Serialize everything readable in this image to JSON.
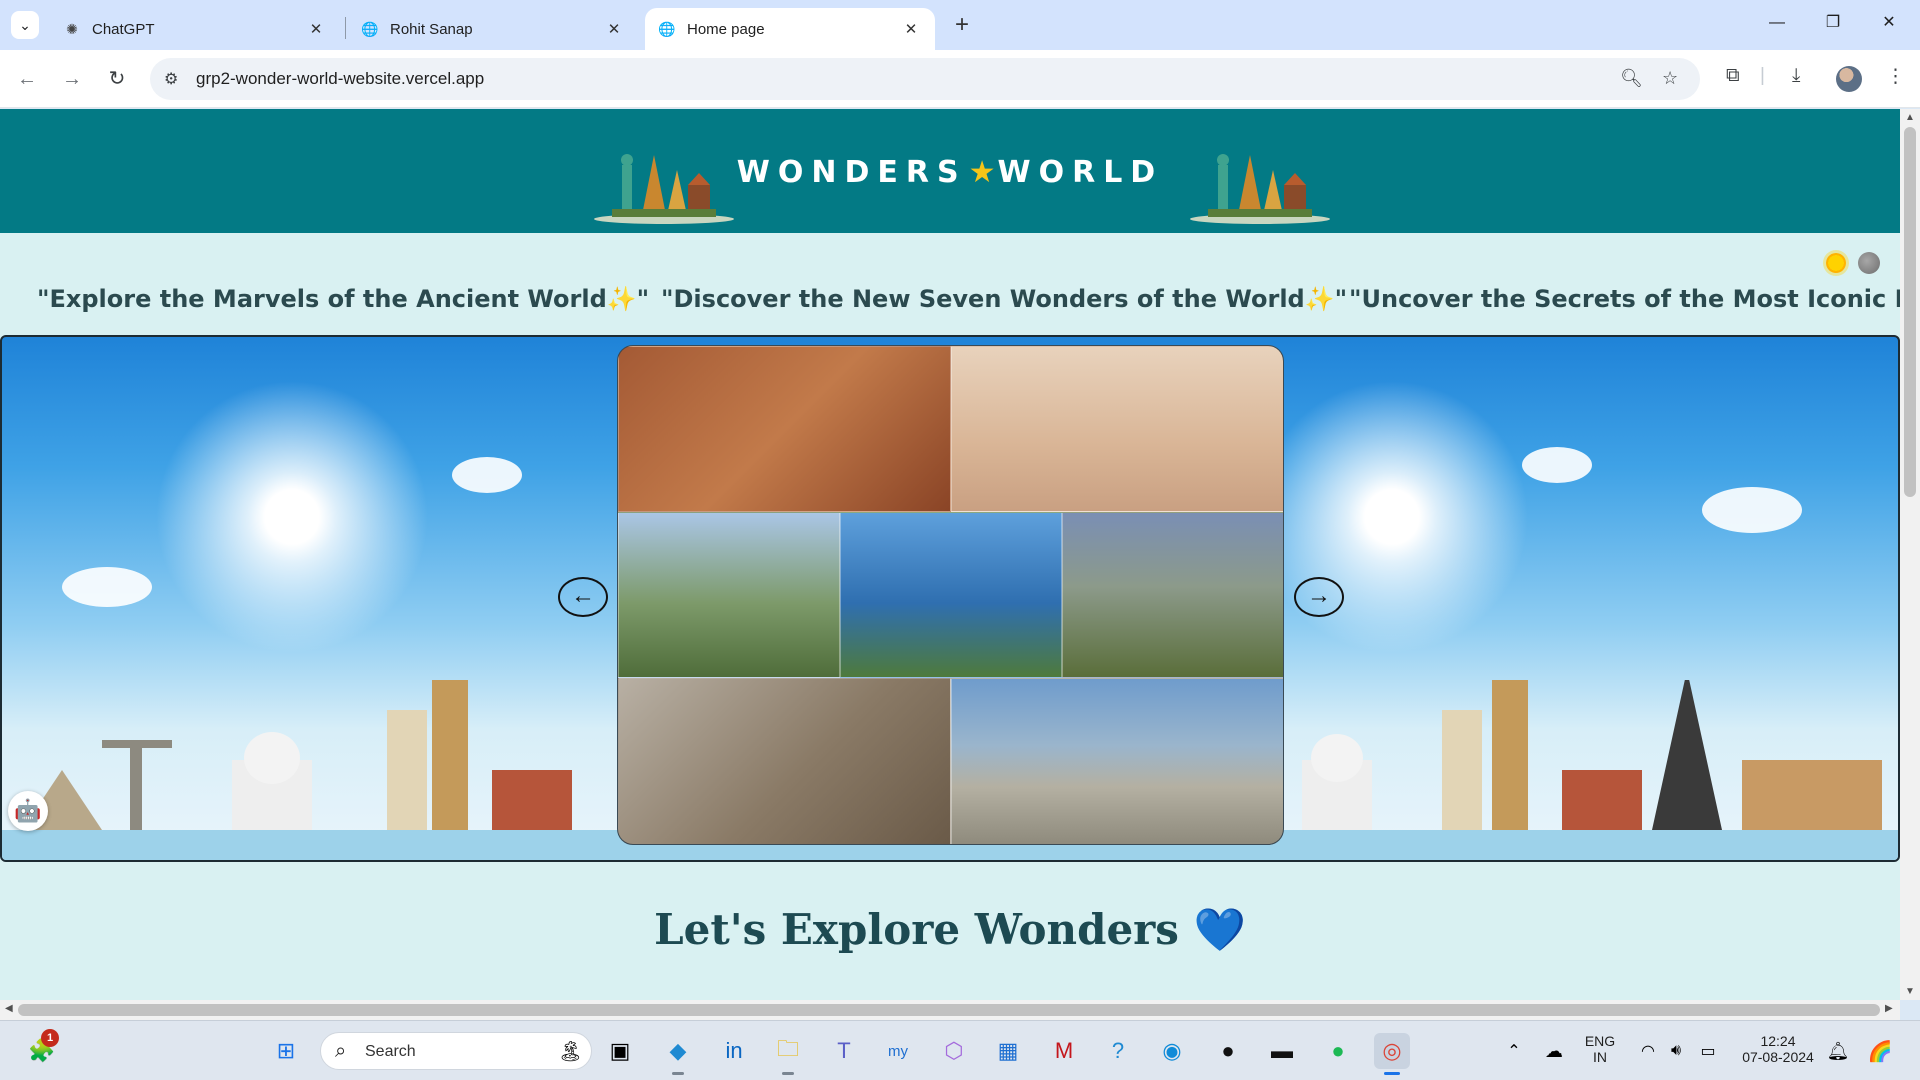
{
  "browser": {
    "tabs": [
      {
        "title": "ChatGPT",
        "favicon": "chatgpt-icon",
        "active": false
      },
      {
        "title": "Rohit Sanap",
        "favicon": "globe-icon",
        "active": false
      },
      {
        "title": "Home page",
        "favicon": "globe-icon",
        "active": true
      }
    ],
    "url": "grp2-wonder-world-website.vercel.app"
  },
  "site": {
    "brand_left": "WONDERS",
    "brand_right": "WORLD",
    "taglines": [
      "\"Explore the Marvels of the Ancient World✨\"",
      "\"Discover the New Seven Wonders of the World✨\"",
      "\"Uncover the Secrets of the Most Iconic Landm"
    ],
    "section_title": "Let's Explore Wonders",
    "section_emoji": "💙",
    "carousel": {
      "prev_label": "←",
      "next_label": "→",
      "images": [
        "Petra",
        "Taj Mahal",
        "Great Wall of China",
        "Christ the Redeemer",
        "Machu Picchu",
        "Colosseum",
        "Chichén Itzá"
      ]
    },
    "colors": {
      "header": "#037a85",
      "page_bg": "#d9f1f2",
      "text": "#2b4a4f"
    }
  },
  "taskbar": {
    "search_placeholder": "Search",
    "notification_count": "1",
    "language_top": "ENG",
    "language_bottom": "IN",
    "time": "12:24",
    "date": "07-08-2024"
  }
}
